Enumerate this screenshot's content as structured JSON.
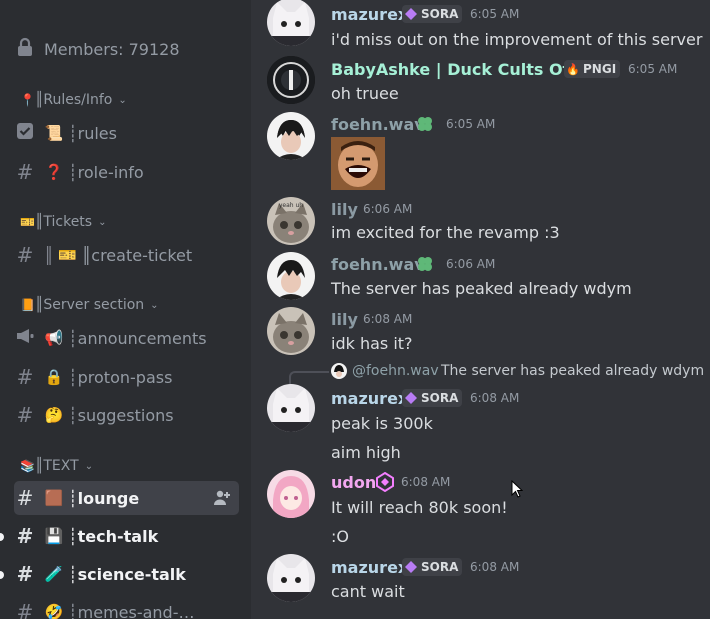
{
  "sidebar": {
    "members_label": "Members: 79128",
    "categories": [
      {
        "emoji": "📍",
        "label": "║Rules/Info"
      },
      {
        "emoji": "🎫",
        "label": "║Tickets"
      },
      {
        "emoji": "📙",
        "label": "║Server section"
      },
      {
        "emoji": "📚",
        "label": "║TEXT"
      }
    ],
    "channels": [
      {
        "icon_type": "checkbox-icon",
        "emoji": "📜",
        "label": "┊rules"
      },
      {
        "icon_type": "hash-icon",
        "emoji": "❓",
        "label": "┊role-info"
      },
      {
        "icon_type": "hash-icon",
        "emoji": "🎫",
        "label": "║create-ticket",
        "prefix": "║"
      },
      {
        "icon_type": "megaphone-icon",
        "emoji": "📢",
        "label": "┊announcements"
      },
      {
        "icon_type": "hash-icon",
        "emoji": "🔒",
        "label": "┊proton-pass"
      },
      {
        "icon_type": "hash-icon",
        "emoji": "🤔",
        "label": "┊suggestions"
      },
      {
        "icon_type": "hash-icon",
        "emoji": "🟫",
        "label": "┊lounge"
      },
      {
        "icon_type": "hash-icon",
        "emoji": "💾",
        "label": "┊tech-talk"
      },
      {
        "icon_type": "hash-icon",
        "emoji": "🧪",
        "label": "┊science-talk"
      },
      {
        "icon_type": "hash-icon",
        "emoji": "🤣",
        "label": "┊memes-and-…"
      }
    ]
  },
  "chat": {
    "messages": [
      {
        "user": "mazurex",
        "tag": "SORA",
        "time": "6:05 AM",
        "text": "i'd miss out on the improvement of this server"
      },
      {
        "user": "BabyAshke | Duck Cults Otter",
        "tag": "PNGI",
        "time": "6:05 AM",
        "text": "oh truee"
      },
      {
        "user": "foehn.wav",
        "time": "6:05 AM",
        "text": ""
      },
      {
        "user": "lily",
        "time": "6:06 AM",
        "text": "im excited for the revamp :3"
      },
      {
        "user": "foehn.wav",
        "time": "6:06 AM",
        "text": "The server has peaked already wdym"
      },
      {
        "user": "lily",
        "time": "6:08 AM",
        "text": "idk has it?"
      },
      {
        "user": "mazurex",
        "tag": "SORA",
        "time": "6:08 AM",
        "text": "peak is 300k",
        "text2": "aim high",
        "reply_user": "@foehn.wav",
        "reply_text": "The server has peaked already wdym"
      },
      {
        "user": "udon",
        "time": "6:08 AM",
        "text": "It will reach 80k soon!",
        "text2": ":O"
      },
      {
        "user": "mazurex",
        "tag": "SORA",
        "time": "6:08 AM",
        "text": "cant wait"
      }
    ]
  },
  "colors": {
    "sidebar_bg": "#2b2d31",
    "chat_bg": "#313338",
    "mazurex": "#b9d6e8",
    "babyashke": "#a6f0d6",
    "foehn": "#8ea1a8",
    "lily": "#8b9aa3",
    "udon": "#f2a7f0",
    "sora_accent": "#b87cf5"
  }
}
